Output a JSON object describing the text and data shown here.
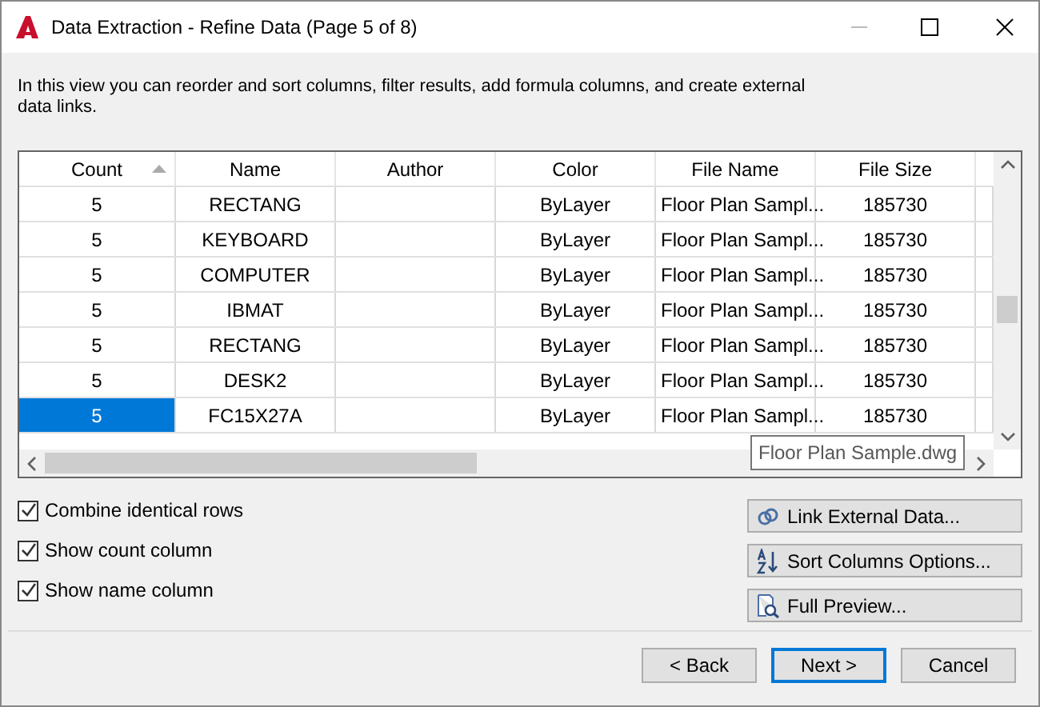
{
  "window": {
    "title": "Data Extraction - Refine Data (Page 5 of 8)"
  },
  "description": "In this view you can reorder and sort columns, filter results, add formula columns, and create external data links.",
  "table": {
    "columns": [
      {
        "label": "Count",
        "sorted": true
      },
      {
        "label": "Name",
        "sorted": false
      },
      {
        "label": "Author",
        "sorted": false
      },
      {
        "label": "Color",
        "sorted": false
      },
      {
        "label": "File Name",
        "sorted": false
      },
      {
        "label": "File Size",
        "sorted": false
      }
    ],
    "rows": [
      {
        "selected": false,
        "cells": [
          "5",
          "RECTANG",
          "",
          "ByLayer",
          "Floor Plan Sampl...",
          "185730"
        ]
      },
      {
        "selected": false,
        "cells": [
          "5",
          "KEYBOARD",
          "",
          "ByLayer",
          "Floor Plan Sampl...",
          "185730"
        ]
      },
      {
        "selected": false,
        "cells": [
          "5",
          "COMPUTER",
          "",
          "ByLayer",
          "Floor Plan Sampl...",
          "185730"
        ]
      },
      {
        "selected": false,
        "cells": [
          "5",
          "IBMAT",
          "",
          "ByLayer",
          "Floor Plan Sampl...",
          "185730"
        ]
      },
      {
        "selected": false,
        "cells": [
          "5",
          "RECTANG",
          "",
          "ByLayer",
          "Floor Plan Sampl...",
          "185730"
        ]
      },
      {
        "selected": false,
        "cells": [
          "5",
          "DESK2",
          "",
          "ByLayer",
          "Floor Plan Sampl...",
          "185730"
        ]
      },
      {
        "selected": true,
        "cells": [
          "5",
          "FC15X27A",
          "",
          "ByLayer",
          "Floor Plan Sampl...",
          "185730"
        ]
      }
    ],
    "tooltip": "Floor Plan Sample.dwg"
  },
  "options": [
    {
      "label": "Combine identical rows",
      "checked": true
    },
    {
      "label": "Show count column",
      "checked": true
    },
    {
      "label": "Show name column",
      "checked": true
    }
  ],
  "side_buttons": [
    {
      "kind": "link",
      "label": "Link External Data..."
    },
    {
      "kind": "sort",
      "label": "Sort Columns Options..."
    },
    {
      "kind": "preview",
      "label": "Full Preview..."
    }
  ],
  "footer_buttons": [
    {
      "label": "< Back",
      "default": false
    },
    {
      "label": "Next >",
      "default": true
    },
    {
      "label": "Cancel",
      "default": false
    }
  ]
}
